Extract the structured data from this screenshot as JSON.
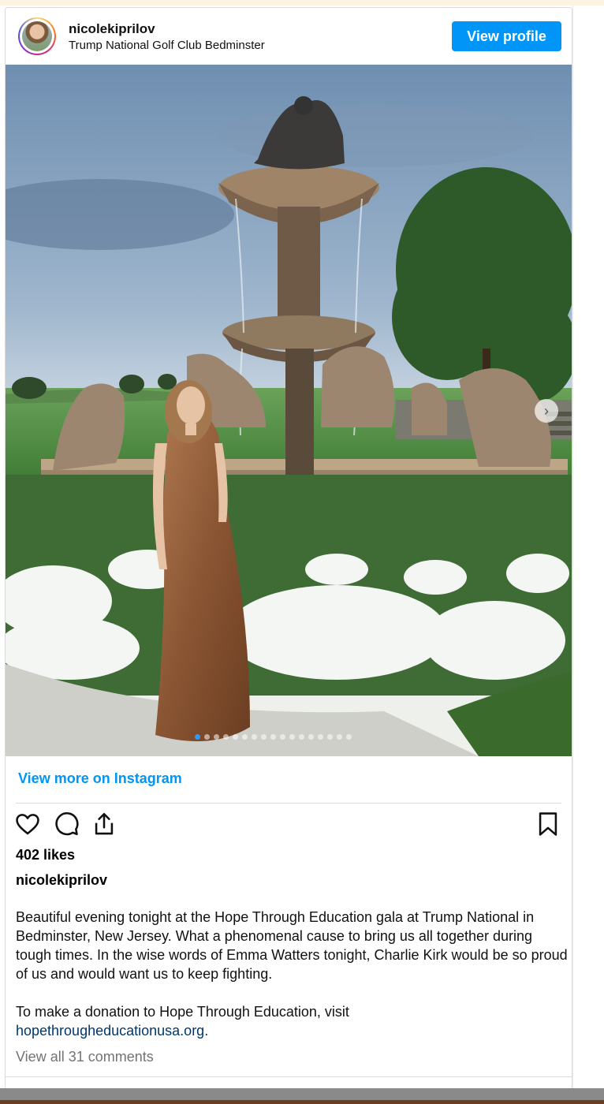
{
  "post": {
    "username": "nicolekiprilov",
    "location": "Trump National Golf Club Bedminster",
    "view_profile_label": "View profile",
    "view_more_label": "View more on Instagram",
    "likes": "402 likes",
    "caption_username": "nicolekiprilov",
    "caption_paragraph_1": "Beautiful evening tonight at the Hope Through Education gala at Trump National in Bedminster, New Jersey. What a phenomenal cause to bring us all together during tough times. In the wise words of Emma Watters tonight, Charlie Kirk would be so proud of us and would want us to keep fighting.",
    "caption_paragraph_2": "To make a donation to Hope Through Education, visit",
    "caption_link": "hopethrougheducationusa.org.",
    "view_comments_label": "View all 31 comments",
    "carousel": {
      "total_slides": 17,
      "active_slide": 1
    }
  },
  "icons": [
    "heart-icon",
    "comment-icon",
    "share-icon",
    "bookmark-icon",
    "chevron-right-icon"
  ],
  "colors": {
    "primary_button": "#0095f6",
    "link": "#00376b",
    "muted_text": "#737373"
  }
}
